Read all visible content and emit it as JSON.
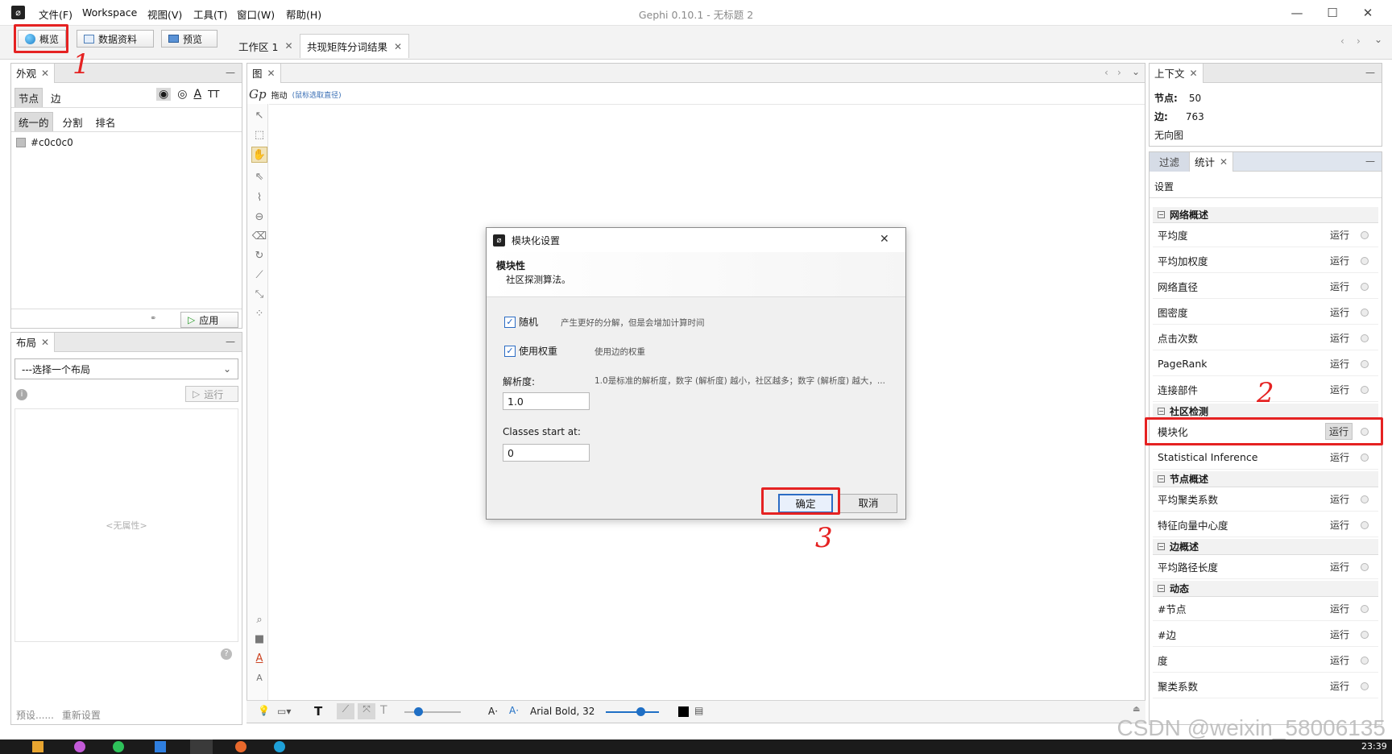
{
  "window": {
    "title": "Gephi 0.10.1 - 无标题 2",
    "menu": [
      "文件(F)",
      "Workspace",
      "视图(V)",
      "工具(T)",
      "窗口(W)",
      "帮助(H)"
    ],
    "controls": {
      "minimize": "—",
      "maximize": "☐",
      "close": "✕"
    }
  },
  "toolbar": {
    "overview": "概览",
    "data_lab": "数据资料",
    "preview": "预览",
    "workspaces": [
      "工作区 1",
      "共现矩阵分词结果"
    ]
  },
  "appearance": {
    "tab": "外观",
    "node_edge": [
      "节点",
      "边"
    ],
    "modes": [
      "统一的",
      "分割",
      "排名"
    ],
    "color_value": "#c0c0c0",
    "apply_label": "应用"
  },
  "layout": {
    "tab": "布局",
    "select_placeholder": "---选择一个布局",
    "run_label": "运行",
    "no_properties": "<无属性>",
    "presets": "预设......",
    "reset": "重新设置"
  },
  "graph": {
    "tab": "图",
    "drag_label": "拖动",
    "drag_hint": "(鼠标选取直径)",
    "font_label": "Arial Bold, 32"
  },
  "context": {
    "tab": "上下文",
    "nodes_label": "节点:",
    "nodes_value": "50",
    "edges_label": "边:",
    "edges_value": "763",
    "graph_type": "无向图"
  },
  "statistics": {
    "tabs": [
      "过滤",
      "统计"
    ],
    "settings": "设置",
    "run": "运行",
    "sections": [
      {
        "title": "网络概述",
        "items": [
          "平均度",
          "平均加权度",
          "网络直径",
          "图密度",
          "点击次数",
          "PageRank",
          "连接部件"
        ]
      },
      {
        "title": "社区检测",
        "items": [
          "模块化",
          "Statistical Inference"
        ]
      },
      {
        "title": "节点概述",
        "items": [
          "平均聚类系数",
          "特征向量中心度"
        ]
      },
      {
        "title": "边概述",
        "items": [
          "平均路径长度"
        ]
      },
      {
        "title": "动态",
        "items": [
          "#节点",
          "#边",
          "度",
          "聚类系数"
        ]
      }
    ]
  },
  "dialog": {
    "title": "模块化设置",
    "heading": "模块性",
    "subheading": "社区探测算法。",
    "randomize_label": "随机",
    "randomize_desc": "产生更好的分解，但是会增加计算时间",
    "use_weights_label": "使用权重",
    "use_weights_desc": "使用边的权重",
    "resolution_label": "解析度:",
    "resolution_desc": "1.0是标准的解析度，数字 (解析度) 越小，社区越多；数字 (解析度) 越大，...",
    "resolution_value": "1.0",
    "classes_label": "Classes start at:",
    "classes_value": "0",
    "ok": "确定",
    "cancel": "取消",
    "close": "✕"
  },
  "annotations": [
    "1",
    "2",
    "3"
  ],
  "watermark": "CSDN @weixin_58006135",
  "clock": "23:39",
  "colors": {
    "accent_red": "#e52222",
    "selection_blue": "#1b5fc1"
  }
}
